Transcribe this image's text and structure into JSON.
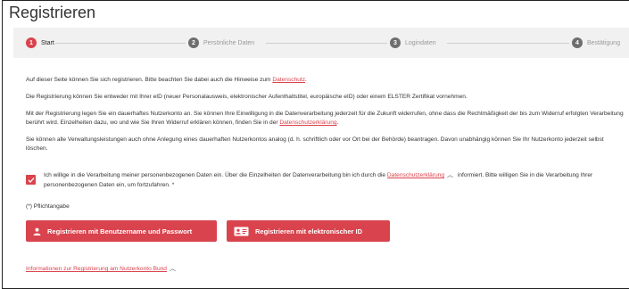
{
  "page": {
    "title": "Registrieren"
  },
  "steps": [
    {
      "num": "1",
      "label": "Start"
    },
    {
      "num": "2",
      "label": "Persönliche Daten"
    },
    {
      "num": "3",
      "label": "Logindaten"
    },
    {
      "num": "4",
      "label": "Bestätigung"
    }
  ],
  "intro": {
    "p1_text": "Auf dieser Seite können Sie sich registrieren. Bitte beachten Sie dabei auch die Hinweise zum ",
    "p1_link": "Datenschutz",
    "p1_end": ".",
    "p2": "Die Registrierung können Sie entweder mit Ihrer eID (neuer Personalausweis, elektronischer Aufenthaltstitel, europäische eID) oder einem ELSTER Zertifikat vornehmen.",
    "p3_text": "Mit der Registrierung legen Sie ein dauerhaftes Nutzerkonto an. Sie können Ihre Einwilligung in die Datenverarbeitung jederzeit für die Zukunft widerrufen, ohne dass die Rechtmäßigkeit der bis zum Widerruf erfolgten Verarbeitung berührt wird. Einzelheiten dazu, wo und wie Sie Ihren Widerruf erklären können, finden Sie in der ",
    "p3_link": "Datenschutzerklärung",
    "p3_end": ".",
    "p4": "Sie können alle Verwaltungsleistungen auch ohne Anlegung eines dauerhaften Nutzerkontos analog (d. h. schriftlich oder vor Ort bei der Behörde) beantragen. Davon unabhängig können Sie Ihr Nutzerkonto jederzeit selbst löschen."
  },
  "consent": {
    "text_before": "Ich willige in die Verarbeitung meiner personenbezogenen Daten ein. Über die Einzelheiten der Datenverarbeitung bin ich durch die ",
    "link": "Datenschutzerklärung",
    "text_after": " informiert. Bitte willigen Sie in die Verarbeitung Ihrer personenbezogenen Daten ein, um fortzufahren. *",
    "checked": true
  },
  "required_note": "(*) Pflichtangabe",
  "buttons": {
    "username": "Registrieren mit Benutzername und Passwort",
    "eid": "Registrieren mit elektronischer ID"
  },
  "info_link": "Informationen zur Registrierung am Nutzerkonto Bund",
  "colors": {
    "accent": "#d9434d",
    "stepper_bg": "#f1f1f1",
    "inactive_step": "#6e6e6e"
  }
}
